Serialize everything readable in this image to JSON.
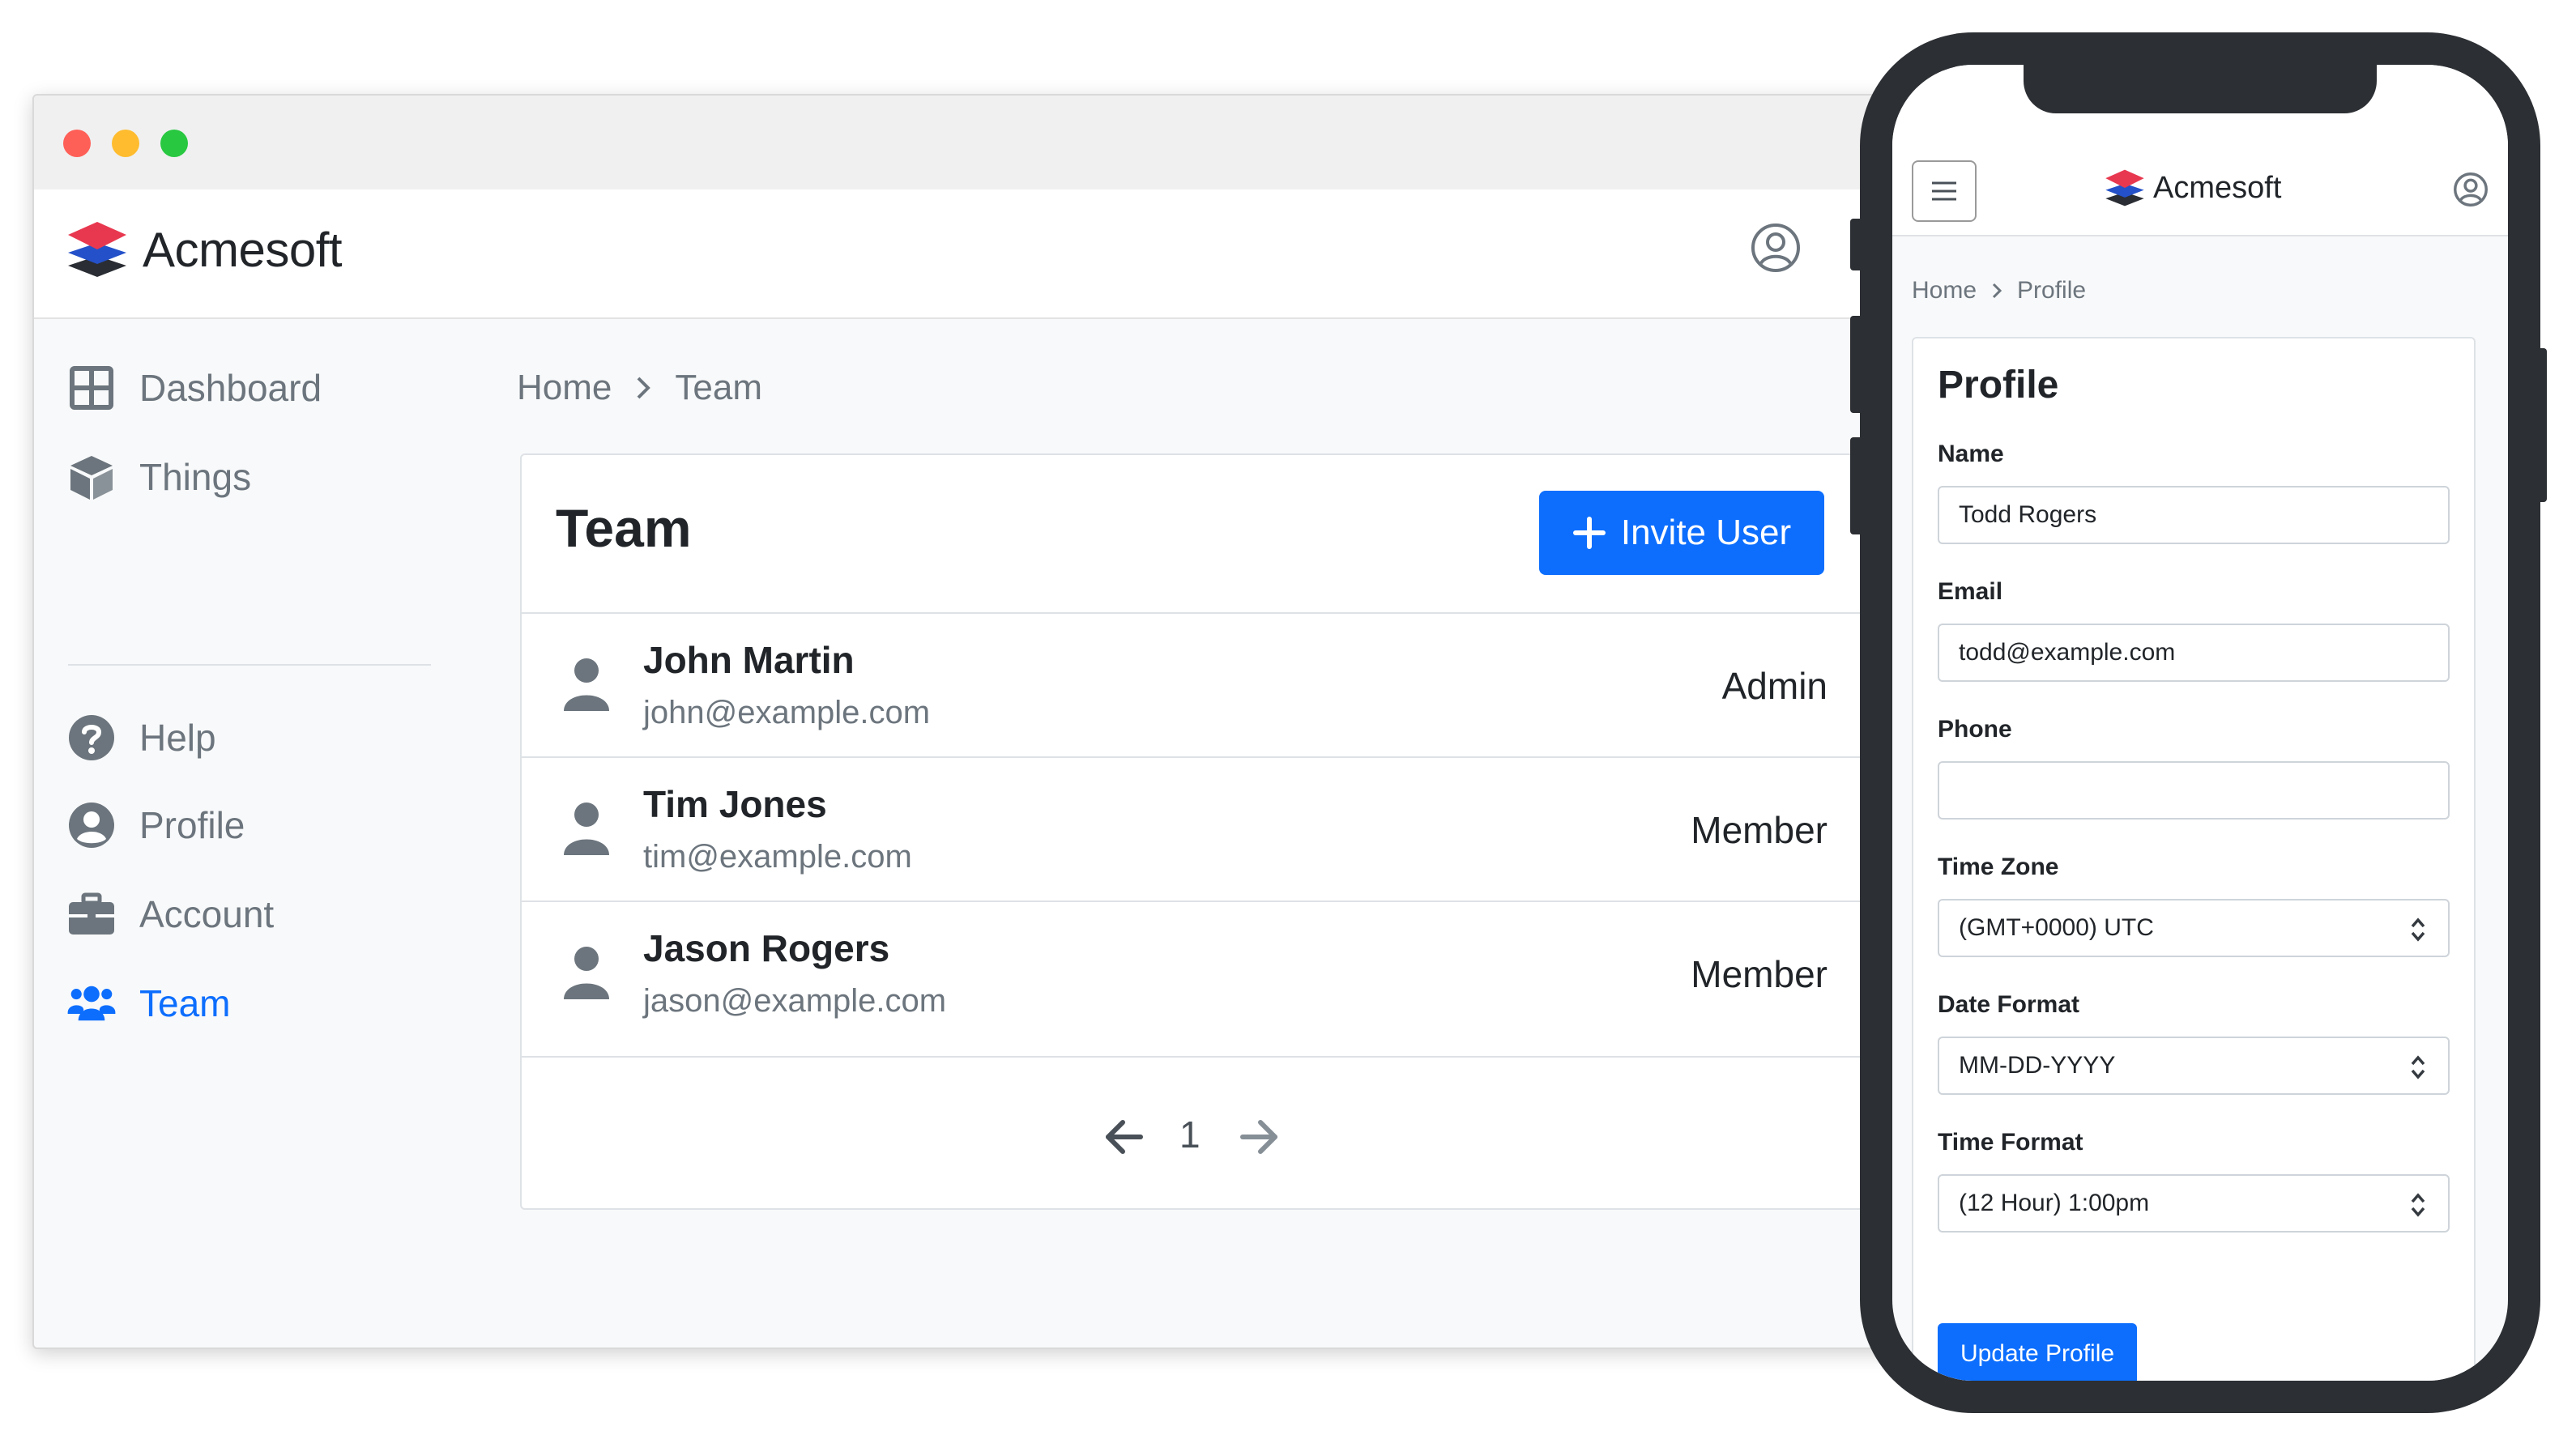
{
  "colors": {
    "primary": "#0d6efd",
    "muted": "#6c757d",
    "text": "#212529",
    "logo_red": "#e8384f",
    "logo_blue": "#2451c9",
    "logo_dark": "#2a2d33"
  },
  "desktop": {
    "brand": "Acmesoft",
    "user_icon": "user-circle-icon",
    "sidebar": {
      "items": [
        {
          "label": "Dashboard",
          "icon": "dashboard-grid-icon"
        },
        {
          "label": "Things",
          "icon": "box-icon"
        },
        {
          "label": "Help",
          "icon": "question-circle-icon"
        },
        {
          "label": "Profile",
          "icon": "user-circle-icon"
        },
        {
          "label": "Account",
          "icon": "briefcase-icon"
        },
        {
          "label": "Team",
          "icon": "users-icon",
          "active": true
        }
      ]
    },
    "breadcrumb": {
      "home": "Home",
      "current": "Team"
    },
    "card": {
      "title": "Team",
      "invite_label": "Invite User",
      "members": [
        {
          "name": "John Martin",
          "email": "john@example.com",
          "role": "Admin"
        },
        {
          "name": "Tim Jones",
          "email": "tim@example.com",
          "role": "Member"
        },
        {
          "name": "Jason Rogers",
          "email": "jason@example.com",
          "role": "Member"
        }
      ],
      "pagination": {
        "current_page": "1"
      }
    }
  },
  "mobile": {
    "brand": "Acmesoft",
    "breadcrumb": {
      "home": "Home",
      "current": "Profile"
    },
    "form": {
      "title": "Profile",
      "name_label": "Name",
      "name_value": "Todd Rogers",
      "email_label": "Email",
      "email_value": "todd@example.com",
      "phone_label": "Phone",
      "phone_value": "",
      "timezone_label": "Time Zone",
      "timezone_value": "(GMT+0000) UTC",
      "date_format_label": "Date Format",
      "date_format_value": "MM-DD-YYYY",
      "time_format_label": "Time Format",
      "time_format_value": "(12 Hour) 1:00pm",
      "submit_label": "Update Profile"
    }
  }
}
